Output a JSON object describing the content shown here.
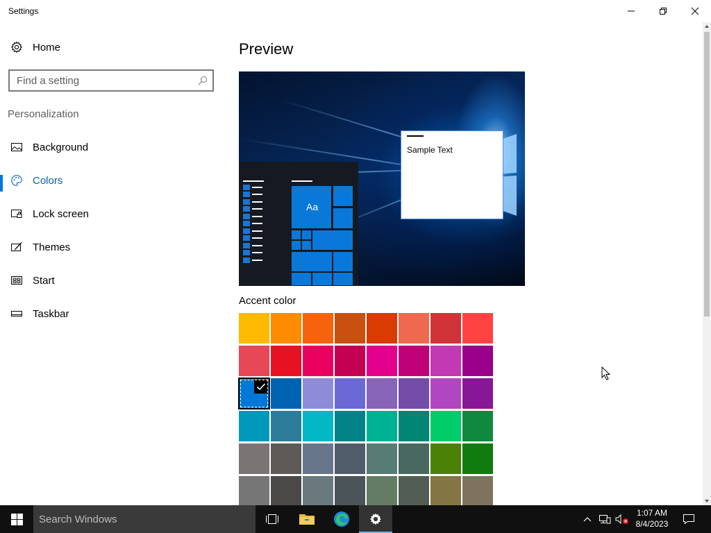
{
  "window": {
    "title": "Settings",
    "minimize_icon": "minimize-icon",
    "restore_icon": "restore-icon",
    "close_icon": "close-icon"
  },
  "sidebar": {
    "home_label": "Home",
    "search_placeholder": "Find a setting",
    "section_label": "Personalization",
    "items": [
      {
        "label": "Background",
        "icon": "picture-icon",
        "active": false
      },
      {
        "label": "Colors",
        "icon": "palette-icon",
        "active": true
      },
      {
        "label": "Lock screen",
        "icon": "lock-screen-icon",
        "active": false
      },
      {
        "label": "Themes",
        "icon": "themes-icon",
        "active": false
      },
      {
        "label": "Start",
        "icon": "start-icon",
        "active": false
      },
      {
        "label": "Taskbar",
        "icon": "taskbar-icon",
        "active": false
      }
    ]
  },
  "main": {
    "preview_title": "Preview",
    "preview_tile_text": "Aa",
    "preview_sample_text": "Sample Text",
    "accent_label": "Accent color",
    "selected_accent": "#0078d7",
    "accent_colors": [
      [
        "#ffb900",
        "#ff8c00",
        "#f7630c",
        "#ca5010",
        "#da3b01",
        "#ef6950",
        "#d13438",
        "#ff4343"
      ],
      [
        "#e74856",
        "#e81123",
        "#ea005e",
        "#c30052",
        "#e3008c",
        "#bf0077",
        "#c239b3",
        "#9a0089"
      ],
      [
        "#0078d7",
        "#0063b1",
        "#8e8cd8",
        "#6b69d6",
        "#8764b8",
        "#744da9",
        "#b146c2",
        "#881798"
      ],
      [
        "#0099bc",
        "#2d7d9a",
        "#00b7c3",
        "#038387",
        "#00b294",
        "#018574",
        "#00cc6a",
        "#10893e"
      ],
      [
        "#7a7574",
        "#5d5a58",
        "#68768a",
        "#515c6b",
        "#567c73",
        "#486860",
        "#498205",
        "#107c10"
      ],
      [
        "#767676",
        "#4c4a48",
        "#69797e",
        "#4a5459",
        "#647c64",
        "#525e54",
        "#847545",
        "#7e735f"
      ]
    ]
  },
  "taskbar": {
    "search_placeholder": "Search Windows",
    "time": "1:07 AM",
    "date": "8/4/2023"
  }
}
